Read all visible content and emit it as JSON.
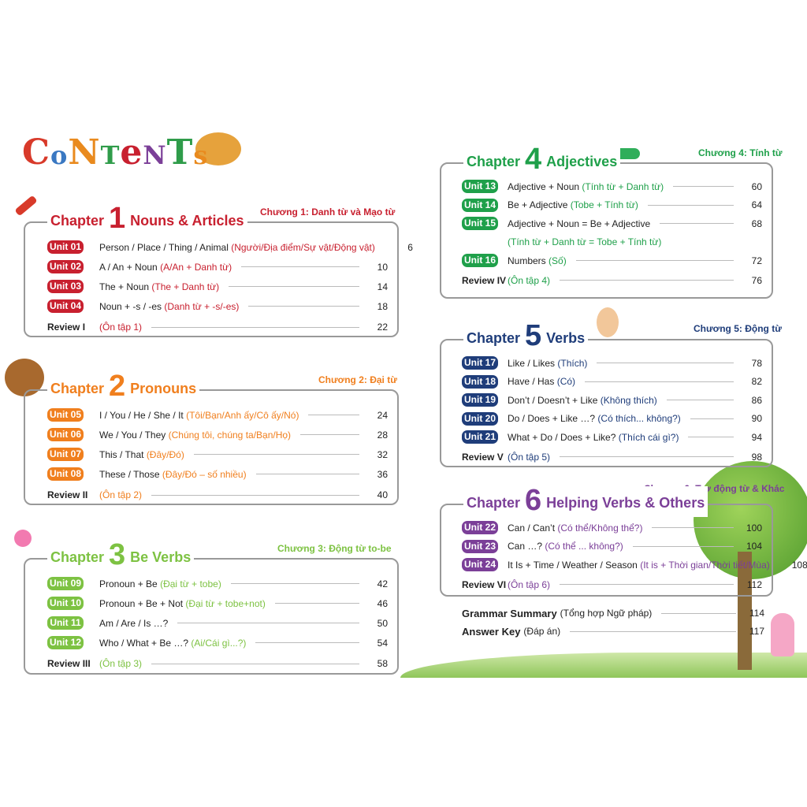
{
  "title_letters": [
    "C",
    "o",
    "N",
    "T",
    "e",
    "N",
    "T",
    "s"
  ],
  "title_colors": [
    "#d83a2a",
    "#3a78c2",
    "#e98a1e",
    "#2f9c4a",
    "#c8202f",
    "#7b3f98",
    "#2f9c4a",
    "#e98a1e"
  ],
  "chapters": [
    {
      "label": "Chapter",
      "number": "1",
      "name": "Nouns & Articles",
      "viet": "Chương 1: Danh từ và Mạo từ",
      "color": "#c8202f",
      "rows": [
        {
          "badge": "Unit 01",
          "text": "Person / Place / Thing / Animal",
          "note": "(Người/Địa điểm/Sự vật/Động vật)",
          "page": "6"
        },
        {
          "badge": "Unit 02",
          "text": "A / An + Noun",
          "note": "(A/An + Danh từ)",
          "page": "10"
        },
        {
          "badge": "Unit 03",
          "text": "The + Noun",
          "note": "(The + Danh từ)",
          "page": "14"
        },
        {
          "badge": "Unit 04",
          "text": "Noun + -s / -es",
          "note": "(Danh từ + -s/-es)",
          "page": "18"
        },
        {
          "review": "Review I",
          "note": "(Ôn tập 1)",
          "page": "22"
        }
      ]
    },
    {
      "label": "Chapter",
      "number": "2",
      "name": "Pronouns",
      "viet": "Chương 2: Đại từ",
      "color": "#f07f1e",
      "rows": [
        {
          "badge": "Unit 05",
          "text": "I / You / He / She / It",
          "note": "(Tôi/Bạn/Anh ấy/Cô ấy/Nó)",
          "page": "24"
        },
        {
          "badge": "Unit 06",
          "text": "We / You / They",
          "note": "(Chúng tôi, chúng ta/Bạn/Họ)",
          "page": "28"
        },
        {
          "badge": "Unit 07",
          "text": "This / That",
          "note": "(Đây/Đó)",
          "page": "32"
        },
        {
          "badge": "Unit 08",
          "text": "These / Those",
          "note": "(Đây/Đó – số nhiều)",
          "page": "36"
        },
        {
          "review": "Review II",
          "note": "(Ôn tập 2)",
          "page": "40"
        }
      ]
    },
    {
      "label": "Chapter",
      "number": "3",
      "name": "Be Verbs",
      "viet": "Chương 3: Động từ to-be",
      "color": "#7dc242",
      "rows": [
        {
          "badge": "Unit 09",
          "text": "Pronoun + Be",
          "note": "(Đại từ + tobe)",
          "page": "42"
        },
        {
          "badge": "Unit 10",
          "text": "Pronoun + Be + Not",
          "note": "(Đại từ + tobe+not)",
          "page": "46"
        },
        {
          "badge": "Unit 11",
          "text": "Am / Are / Is …?",
          "note": "",
          "page": "50"
        },
        {
          "badge": "Unit 12",
          "text": "Who / What + Be …?",
          "note": "(Ai/Cái gì...?)",
          "page": "54"
        },
        {
          "review": "Review III",
          "note": "(Ôn tập 3)",
          "page": "58"
        }
      ]
    },
    {
      "label": "Chapter",
      "number": "4",
      "name": "Adjectives",
      "viet": "Chương 4: Tính từ",
      "color": "#1fa04a",
      "rows": [
        {
          "badge": "Unit 13",
          "text": "Adjective + Noun",
          "note": "(Tính từ + Danh từ)",
          "page": "60"
        },
        {
          "badge": "Unit 14",
          "text": "Be + Adjective",
          "note": "(Tobe + Tính từ)",
          "page": "64"
        },
        {
          "badge": "Unit 15",
          "text": "Adjective + Noun = Be + Adjective",
          "note": "",
          "page": "68"
        },
        {
          "sub": "(Tính từ + Danh từ = Tobe + Tính từ)"
        },
        {
          "badge": "Unit 16",
          "text": "Numbers",
          "note": "(Số)",
          "page": "72"
        },
        {
          "review": "Review IV",
          "note": "(Ôn tập 4)",
          "page": "76"
        }
      ]
    },
    {
      "label": "Chapter",
      "number": "5",
      "name": "Verbs",
      "viet": "Chương 5: Động từ",
      "color": "#1f3d7a",
      "rows": [
        {
          "badge": "Unit 17",
          "text": "Like / Likes",
          "note": "(Thích)",
          "page": "78"
        },
        {
          "badge": "Unit 18",
          "text": "Have / Has",
          "note": "(Có)",
          "page": "82"
        },
        {
          "badge": "Unit 19",
          "text": "Don’t / Doesn’t + Like",
          "note": "(Không thích)",
          "page": "86"
        },
        {
          "badge": "Unit 20",
          "text": "Do / Does + Like …?",
          "note": "(Có thích... không?)",
          "page": "90"
        },
        {
          "badge": "Unit 21",
          "text": "What + Do / Does + Like?",
          "note": "(Thích cái gì?)",
          "page": "94"
        },
        {
          "review": "Review V",
          "note": "(Ôn tập 5)",
          "page": "98"
        }
      ]
    },
    {
      "label": "Chapter",
      "number": "6",
      "name": "Helping Verbs & Others",
      "viet": "Chương 6: Trợ động từ & Khác",
      "color": "#7b3f98",
      "rows": [
        {
          "badge": "Unit 22",
          "text": "Can / Can’t",
          "note": "(Có thể/Không thể?)",
          "page": "100"
        },
        {
          "badge": "Unit 23",
          "text": "Can …?",
          "note": "(Có thể ... không?)",
          "page": "104"
        },
        {
          "badge": "Unit 24",
          "text": "It Is + Time / Weather / Season",
          "note": "(It is + Thời gian/Thời tiết/Mùa)",
          "page": "108"
        },
        {
          "review": "Review VI",
          "note": "(Ôn tập 6)",
          "page": "112"
        }
      ]
    }
  ],
  "extras": [
    {
      "title": "Grammar Summary",
      "note": "(Tổng hợp Ngữ pháp)",
      "page": "114"
    },
    {
      "title": "Answer Key",
      "note": "(Đáp án)",
      "page": "117"
    }
  ]
}
